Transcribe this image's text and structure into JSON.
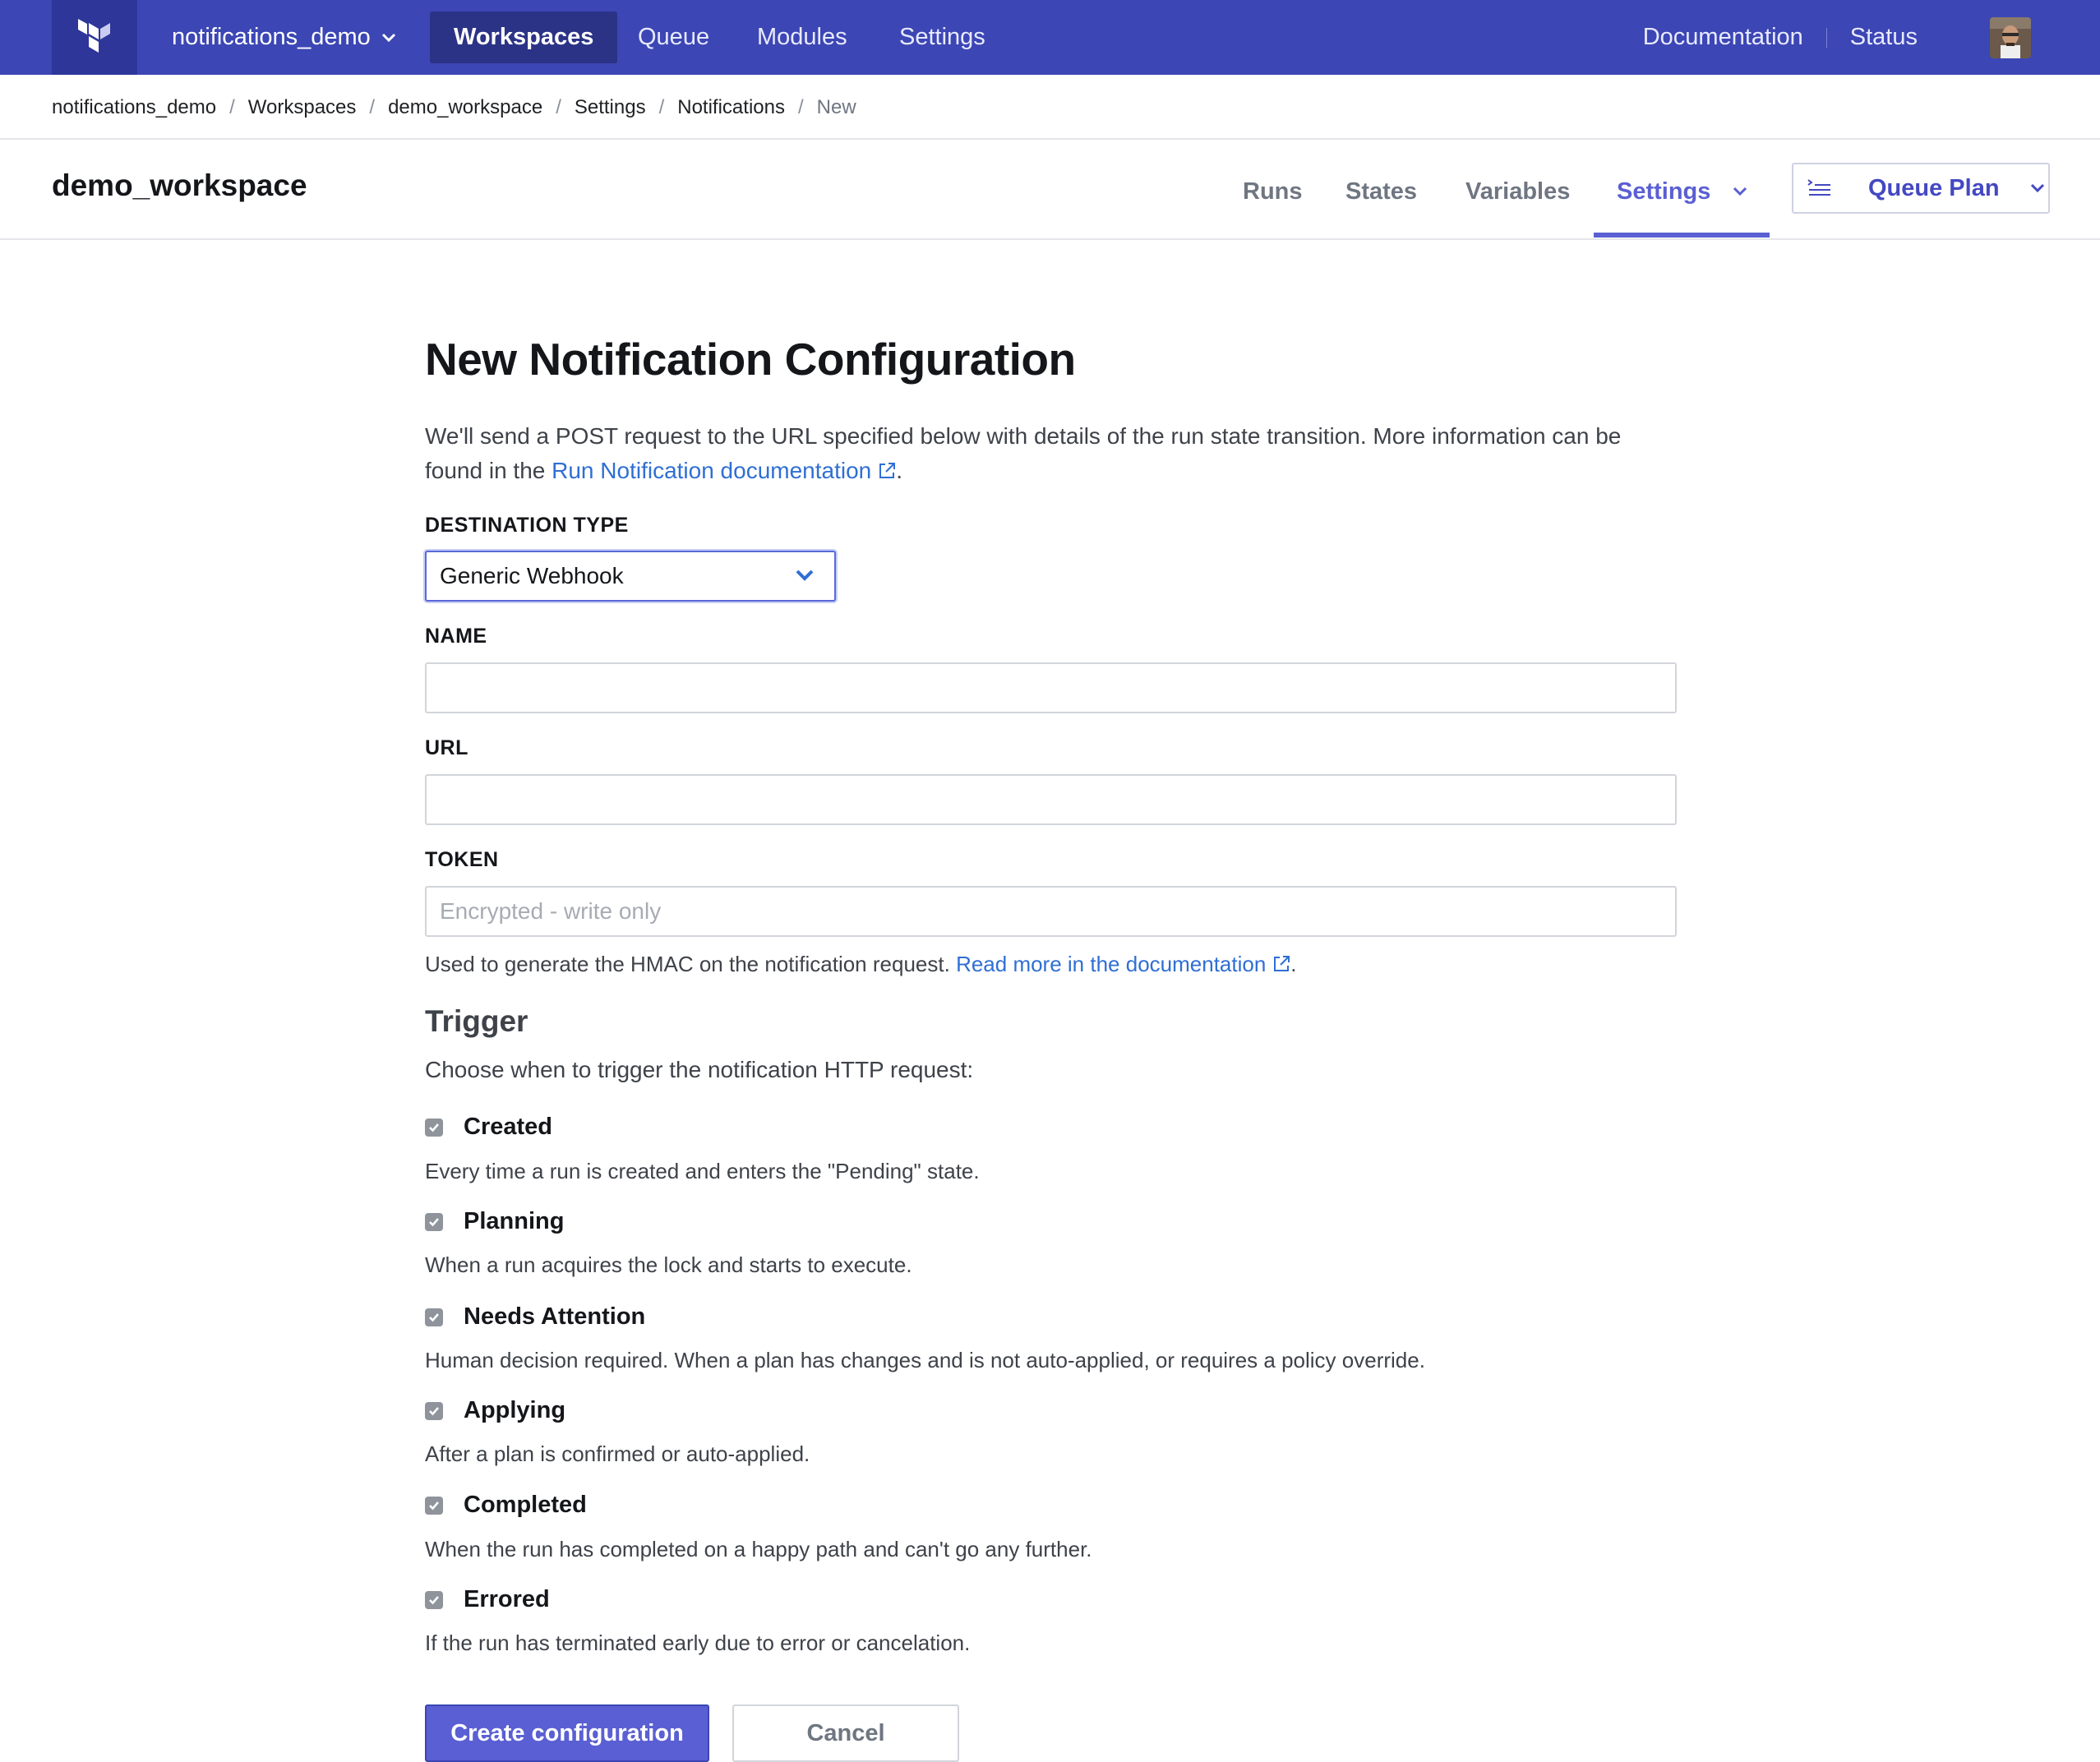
{
  "topnav": {
    "org": "notifications_demo",
    "items": [
      "Workspaces",
      "Queue",
      "Modules",
      "Settings"
    ],
    "active": "Workspaces",
    "right_links": [
      "Documentation",
      "Status"
    ],
    "brand_color": "#3c46b4"
  },
  "breadcrumb": [
    "notifications_demo",
    "Workspaces",
    "demo_workspace",
    "Settings",
    "Notifications",
    "New"
  ],
  "workspace": {
    "title": "demo_workspace",
    "tabs": [
      "Runs",
      "States",
      "Variables",
      "Settings"
    ],
    "active_tab": "Settings",
    "queue_button": "Queue Plan",
    "accent_color": "#5a5fd3"
  },
  "form": {
    "title": "New Notification Configuration",
    "intro_text": "We'll send a POST request to the URL specified below with details of the run state transition. More information can be found in the",
    "intro_link": "Run Notification documentation",
    "destination_label": "DESTINATION TYPE",
    "destination_value": "Generic Webhook",
    "name_label": "NAME",
    "name_value": "",
    "url_label": "URL",
    "url_value": "",
    "token_label": "TOKEN",
    "token_placeholder": "Encrypted - write only",
    "token_help": "Used to generate the HMAC on the notification request.",
    "token_help_link": "Read more in the documentation",
    "trigger_title": "Trigger",
    "trigger_sub": "Choose when to trigger the notification HTTP request:",
    "triggers": [
      {
        "label": "Created",
        "desc": "Every time a run is created and enters the \"Pending\" state.",
        "checked": true
      },
      {
        "label": "Planning",
        "desc": "When a run acquires the lock and starts to execute.",
        "checked": true
      },
      {
        "label": "Needs Attention",
        "desc": "Human decision required. When a plan has changes and is not auto-applied, or requires a policy override.",
        "checked": true
      },
      {
        "label": "Applying",
        "desc": "After a plan is confirmed or auto-applied.",
        "checked": true
      },
      {
        "label": "Completed",
        "desc": "When the run has completed on a happy path and can't go any further.",
        "checked": true
      },
      {
        "label": "Errored",
        "desc": "If the run has terminated early due to error or cancelation.",
        "checked": true
      }
    ],
    "create_button": "Create configuration",
    "cancel_button": "Cancel"
  }
}
